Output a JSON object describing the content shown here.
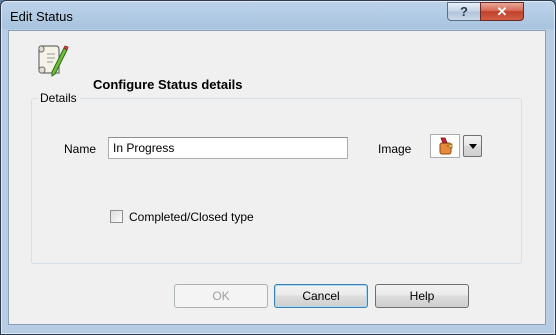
{
  "window": {
    "title": "Edit Status",
    "help_glyph": "?",
    "close_glyph": "✕"
  },
  "header": {
    "text": "Configure Status details",
    "icon": "scroll-pen-icon"
  },
  "details": {
    "legend": "Details",
    "name_label": "Name",
    "name_value": "In Progress",
    "image_label": "Image",
    "image_icon": "status-image-icon",
    "completed_label": "Completed/Closed type",
    "completed_checked": false
  },
  "buttons": {
    "ok": "OK",
    "cancel": "Cancel",
    "help": "Help"
  }
}
